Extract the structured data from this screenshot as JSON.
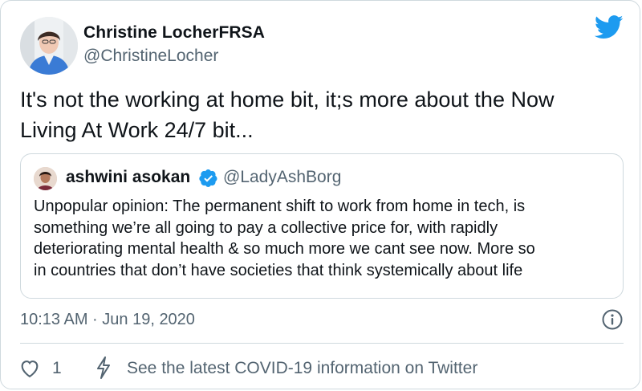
{
  "author": {
    "name": "Christine LocherFRSA",
    "handle": "@ChristineLocher"
  },
  "tweet": {
    "text_line1": "It's not the working at home bit, it;s more about the Now",
    "text_line2": "Living At Work 24/7 bit..."
  },
  "quoted_tweet": {
    "name": "ashwini asokan",
    "handle": "@LadyAshBorg",
    "verified": true,
    "lines": [
      "Unpopular opinion: The permanent shift to work from home in tech, is",
      "something we’re all going to pay a collective price for, with rapidly",
      "deteriorating mental health & so much more we cant see now. More so",
      "in countries that don’t have societies that think systemically about life"
    ]
  },
  "meta": {
    "timestamp": "10:13 AM · Jun 19, 2020"
  },
  "actions": {
    "like_count": "1",
    "covid_link": "See the latest COVID-19 information on Twitter"
  },
  "icons": {
    "brand": "twitter-bird-icon",
    "verified": "verified-badge-icon",
    "info": "info-icon",
    "like": "heart-icon",
    "covid": "lightning-bolt-icon"
  },
  "colors": {
    "twitter_blue": "#1d9bf0",
    "text": "#0f1419",
    "secondary": "#536471",
    "border": "#cfd9de"
  }
}
